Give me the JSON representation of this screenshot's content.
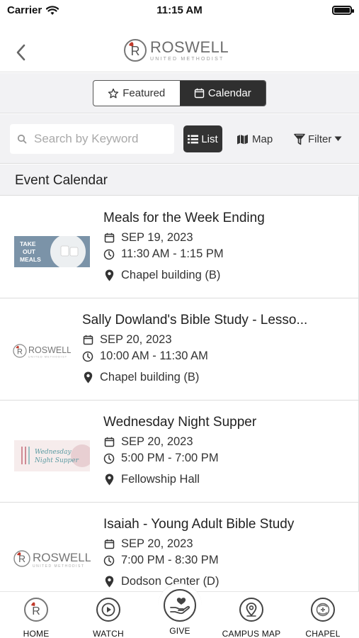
{
  "status_bar": {
    "carrier": "Carrier",
    "time": "11:15 AM"
  },
  "header": {
    "logo_word": "ROSWELL",
    "logo_sub": "UNITED METHODIST",
    "logo_letter": "R"
  },
  "segment": {
    "featured_label": "Featured",
    "calendar_label": "Calendar",
    "active": "Calendar"
  },
  "search": {
    "placeholder": "Search by Keyword",
    "value": ""
  },
  "view_toggle": {
    "list_label": "List",
    "map_label": "Map",
    "filter_label": "Filter",
    "active": "List"
  },
  "section": {
    "title": "Event Calendar"
  },
  "events": [
    {
      "title": "Meals for the Week Ending",
      "date": "SEP 19, 2023",
      "time": "11:30 AM - 1:15 PM",
      "location": "Chapel building (B)",
      "thumb": "take-out-meals",
      "thumb_text": "TAKE OUT MEALS"
    },
    {
      "title": "Sally Dowland's Bible Study - Lesso...",
      "date": "SEP 20, 2023",
      "time": "10:00 AM - 11:30 AM",
      "location": "Chapel building (B)",
      "thumb": "roswell-logo",
      "thumb_text": "ROSWELL"
    },
    {
      "title": "Wednesday Night Supper",
      "date": "SEP 20, 2023",
      "time": "5:00 PM - 7:00 PM",
      "location": "Fellowship Hall",
      "thumb": "wednesday-night-supper",
      "thumb_text": "Wednesday Night Supper"
    },
    {
      "title": "Isaiah - Young Adult Bible Study",
      "date": "SEP 20, 2023",
      "time": "7:00 PM - 8:30 PM",
      "location": "Dodson Center (D)",
      "thumb": "roswell-logo",
      "thumb_text": "ROSWELL"
    }
  ],
  "tab_bar": {
    "items": [
      {
        "label": "HOME",
        "icon": "home-logo-icon"
      },
      {
        "label": "WATCH",
        "icon": "play-icon"
      },
      {
        "label": "GIVE",
        "icon": "heart-hand-icon"
      },
      {
        "label": "CAMPUS MAP",
        "icon": "map-pin-icon"
      },
      {
        "label": "CHAPEL",
        "icon": "chapel-icon"
      }
    ]
  },
  "colors": {
    "accent_dark": "#2f2f2f",
    "brand_red": "#c0392b",
    "brand_gray": "#6d6d6d",
    "background_gray": "#f2f2f4"
  }
}
